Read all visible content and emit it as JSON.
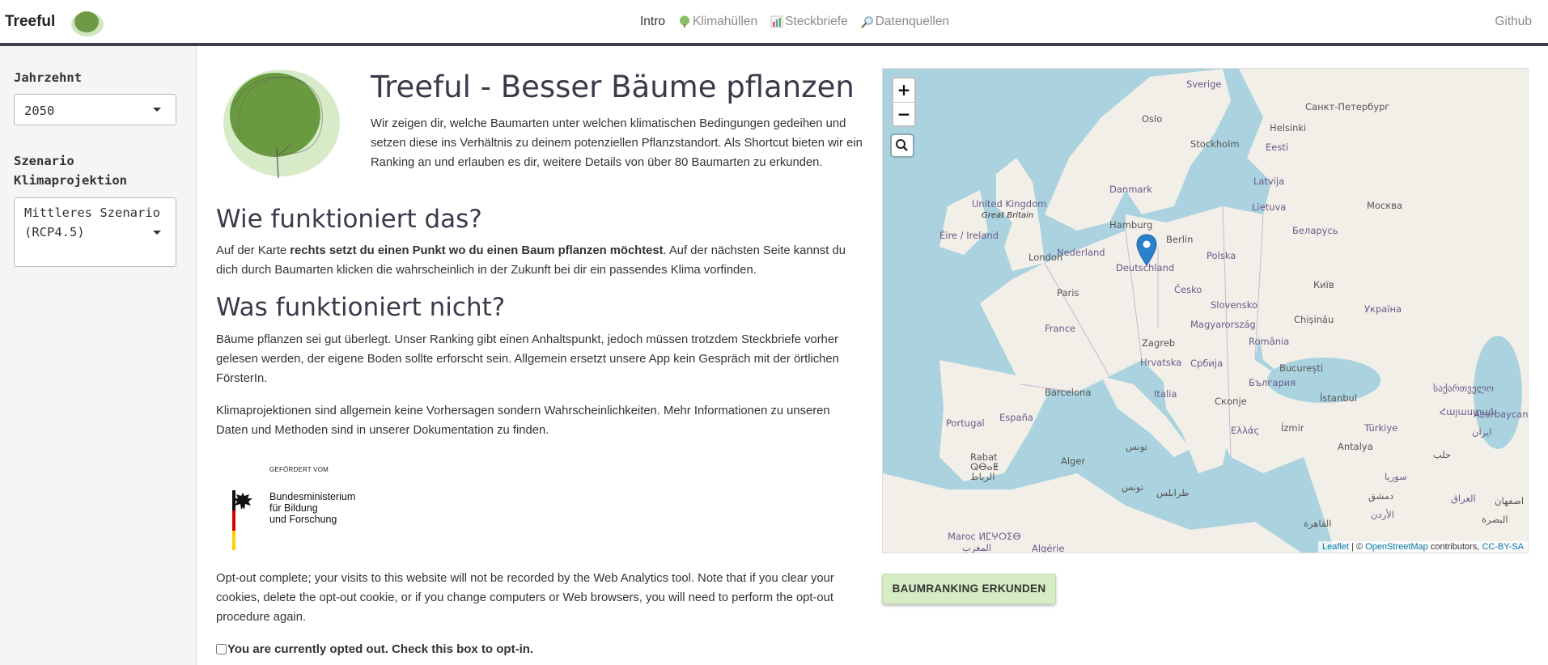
{
  "navbar": {
    "brand": "Treeful",
    "items": [
      {
        "label": "Intro",
        "icon": "none"
      },
      {
        "label": "Klimahüllen",
        "icon": "tree-icon"
      },
      {
        "label": "Steckbriefe",
        "icon": "bar-chart-icon"
      },
      {
        "label": "Datenquellen",
        "icon": "magnifier-icon"
      }
    ],
    "github": "Github"
  },
  "sidebar": {
    "decade_label": "Jahrzehnt",
    "decade_value": "2050",
    "scenario_label_1": "Szenario",
    "scenario_label_2": "Klimaprojektion",
    "scenario_value_1": "Mittleres Szenario",
    "scenario_value_2": "(RCP4.5)"
  },
  "main": {
    "title": "Treeful - Besser Bäume pflanzen",
    "intro": "Wir zeigen dir, welche Baumarten unter welchen klimatischen Bedingungen gedeihen und setzen diese ins Verhältnis zu deinem potenziellen Pflanzstandort. Als Shortcut bieten wir ein Ranking an und erlauben es dir, weitere Details von über 80 Baumarten zu erkunden.",
    "how_heading": "Wie funktioniert das?",
    "how_pre": "Auf der Karte ",
    "how_bold": "rechts setzt du einen Punkt wo du einen Baum pflanzen möchtest",
    "how_post": ". Auf der nächsten Seite kannst du dich durch Baumarten klicken die wahrscheinlich in der Zukunft bei dir ein passendes Klima vorfinden.",
    "not_heading": "Was funktioniert nicht?",
    "not_text": "Bäume pflanzen sei gut überlegt. Unser Ranking gibt einen Anhaltspunkt, jedoch müssen trotzdem Steckbriefe vorher gelesen werden, der eigene Boden sollte erforscht sein. Allgemein ersetzt unsere App kein Gespräch mit der örtlichen FörsterIn.",
    "climate_text": "Klimaprojektionen sind allgemein keine Vorhersagen sondern Wahrscheinlichkeiten. Mehr Informationen zu unseren Daten und Methoden sind in unserer Dokumentation zu finden.",
    "funder_small": "GEFÖRDERT VOM",
    "funder_line1": "Bundesministerium",
    "funder_line2": "für Bildung",
    "funder_line3": "und Forschung",
    "optout_text": "Opt-out complete; your visits to this website will not be recorded by the Web Analytics tool. Note that if you clear your cookies, delete the opt-out cookie, or if you change computers or Web browsers, you will need to perform the opt-out procedure again.",
    "optin_label": "You are currently opted out. Check this box to opt-in.",
    "cta": "BAUMRANKING ERKUNDEN"
  },
  "map": {
    "zoom_in": "+",
    "zoom_out": "−",
    "attribution_leaflet": "Leaflet",
    "attribution_sep": " | © ",
    "attribution_osm": "OpenStreetMap",
    "attribution_contrib": " contributors, ",
    "attribution_license": "CC-BY-SA",
    "labels": {
      "sverige": "Sverige",
      "oslo": "Oslo",
      "stockholm": "Stockholm",
      "helsinki": "Helsinki",
      "spb": "Санкт-Петербург",
      "eesti": "Eesti",
      "latvija": "Latvija",
      "lietuva": "Lietuva",
      "moskva": "Москва",
      "belarus": "Беларусь",
      "danmark": "Danmark",
      "uk": "United Kingdom",
      "gb": "Great Britain",
      "eire": "Éire / Ireland",
      "hamburg": "Hamburg",
      "berlin": "Berlin",
      "nederland": "Nederland",
      "london": "London",
      "deutschland": "Deutschland",
      "polska": "Polska",
      "kyiv": "Київ",
      "ukraina": "Україна",
      "paris": "Paris",
      "cesko": "Česko",
      "slovensko": "Slovensko",
      "france": "France",
      "magyar": "Magyarország",
      "chisinau": "Chișinău",
      "zagreb": "Zagreb",
      "romania": "România",
      "hrvatska": "Hrvatska",
      "srbija": "Србија",
      "bucuresti": "București",
      "bulgaria": "България",
      "barcelona": "Barcelona",
      "italia": "Italia",
      "skopje": "Скопје",
      "istanbul": "İstanbul",
      "georgia": "საქართველო",
      "portugal": "Portugal",
      "espana": "España",
      "ellas": "Ελλάς",
      "izmir": "İzmir",
      "turkiye": "Türkiye",
      "armenia": "Հայաստան",
      "iran": "ایران",
      "azerbaycan": "Azərbaycan",
      "rabat": "Rabat",
      "rabat2": "ⵕⴱⴰⵟ",
      "rabat3": "الرباط",
      "alger": "Alger",
      "tunis": "تونس",
      "tunis2": "تونس",
      "tripoli": "طرابلس",
      "antalya": "Antalya",
      "halab": "حلب",
      "suriya": "سوريا",
      "iraq": "العراق",
      "dimashq": "دمشق",
      "urdun": "الأردن",
      "isfahan": "اصفهان",
      "basra": "البصرة",
      "qahira": "القاهرة",
      "maroc": "Maroc ⵍⵎⵖⵔⵉⴱ",
      "maghrib": "المغرب",
      "algerie": "Algérie"
    }
  }
}
